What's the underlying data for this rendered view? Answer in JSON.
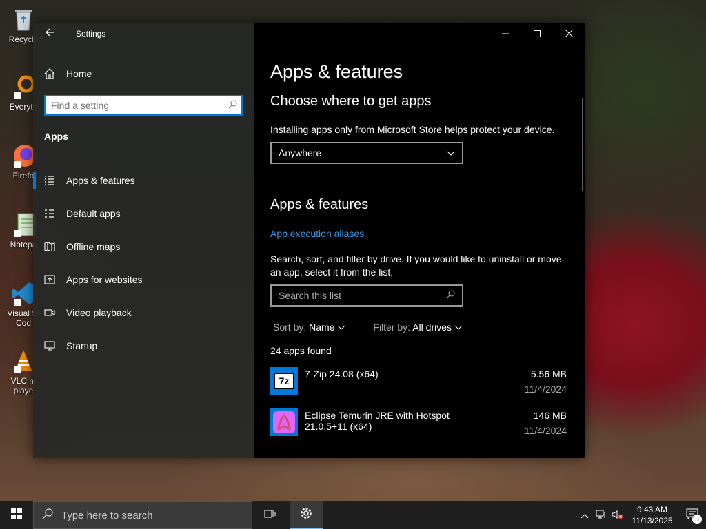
{
  "desktop": {
    "icons": [
      {
        "label": "Recycle",
        "icon": "recycle-bin-icon"
      },
      {
        "label": "Everyth",
        "icon": "everything-search-icon"
      },
      {
        "label": "Firefo",
        "icon": "firefox-icon"
      },
      {
        "label": "Notepa",
        "icon": "notepad-icon"
      },
      {
        "label": "Visual St",
        "label2": "Cod",
        "icon": "vscode-icon"
      },
      {
        "label": "VLC m",
        "label2": "playe",
        "icon": "vlc-icon"
      }
    ]
  },
  "window": {
    "title": "Settings",
    "controls": {
      "minimize": "—",
      "maximize": "☐",
      "close": "✕"
    }
  },
  "sidebar": {
    "home_label": "Home",
    "search_placeholder": "Find a setting",
    "section_label": "Apps",
    "items": [
      {
        "label": "Apps & features",
        "icon": "apps-features-icon",
        "active": true
      },
      {
        "label": "Default apps",
        "icon": "default-apps-icon"
      },
      {
        "label": "Offline maps",
        "icon": "offline-maps-icon"
      },
      {
        "label": "Apps for websites",
        "icon": "apps-for-websites-icon"
      },
      {
        "label": "Video playback",
        "icon": "video-playback-icon"
      },
      {
        "label": "Startup",
        "icon": "startup-icon"
      }
    ]
  },
  "main": {
    "page_title": "Apps & features",
    "choose_heading": "Choose where to get apps",
    "choose_desc": "Installing apps only from Microsoft Store helps protect your device.",
    "source_dropdown_value": "Anywhere",
    "apps_heading": "Apps & features",
    "aliases_link": "App execution aliases",
    "search_desc": "Search, sort, and filter by drive. If you would like to uninstall or move an app, select it from the list.",
    "search_placeholder": "Search this list",
    "sort_label": "Sort by:",
    "sort_value": "Name",
    "filter_label": "Filter by:",
    "filter_value": "All drives",
    "count_text": "24 apps found",
    "apps": [
      {
        "name": "7-Zip 24.08 (x64)",
        "size": "5.56 MB",
        "date": "11/4/2024",
        "icon": "7zip-icon",
        "icon_text": "7z"
      },
      {
        "name": "Eclipse Temurin JRE with Hotspot 21.0.5+11 (x64)",
        "size": "146 MB",
        "date": "11/4/2024",
        "icon": "temurin-icon"
      }
    ]
  },
  "taskbar": {
    "search_placeholder": "Type here to search",
    "time": "9:43 AM",
    "date": "11/13/2025",
    "notification_count": "3"
  },
  "colors": {
    "accent": "#0078d7",
    "link": "#3a96dd"
  }
}
